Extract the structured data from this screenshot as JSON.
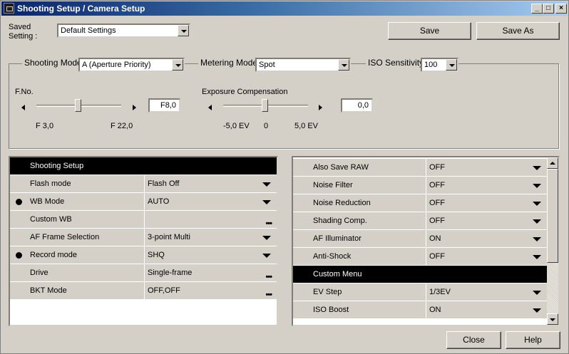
{
  "window": {
    "title": "Shooting Setup / Camera Setup"
  },
  "saved_setting": {
    "label_line1": "Saved",
    "label_line2": "Setting :",
    "value": "Default Settings",
    "save_label": "Save",
    "save_as_label": "Save As"
  },
  "shooting_mode": {
    "label": "Shooting Mode",
    "value": "A (Aperture Priority)"
  },
  "metering_mode": {
    "label": "Metering Mode",
    "value": "Spot"
  },
  "iso": {
    "label": "ISO Sensitivity",
    "value": "100"
  },
  "fno": {
    "label": "F.No.",
    "value": "F8,0",
    "min_label": "F 3,0",
    "max_label": "F 22,0",
    "level": 0.5
  },
  "exposure": {
    "label": "Exposure Compensation",
    "value": "0,0",
    "min_label": "-5,0 EV",
    "mid_label": "0",
    "max_label": "5,0 EV",
    "level": 0.5
  },
  "left_table": {
    "header": "Shooting Setup",
    "rows": [
      {
        "name": "Flash mode",
        "value": "Flash Off",
        "control": "dropdown",
        "bullet": false
      },
      {
        "name": "WB Mode",
        "value": "AUTO",
        "control": "dropdown",
        "bullet": true
      },
      {
        "name": "Custom WB",
        "value": "",
        "control": "ellipsis",
        "bullet": false
      },
      {
        "name": "AF Frame Selection",
        "value": "3-point Multi",
        "control": "dropdown",
        "bullet": false
      },
      {
        "name": "Record mode",
        "value": "SHQ",
        "control": "dropdown",
        "bullet": true
      },
      {
        "name": "Drive",
        "value": "Single-frame",
        "control": "ellipsis",
        "bullet": false
      },
      {
        "name": "BKT Mode",
        "value": "OFF,OFF",
        "control": "ellipsis",
        "bullet": false
      }
    ]
  },
  "right_table": {
    "rows": [
      {
        "name": "Also Save RAW",
        "value": "OFF",
        "control": "dropdown"
      },
      {
        "name": "Noise Filter",
        "value": "OFF",
        "control": "dropdown"
      },
      {
        "name": "Noise Reduction",
        "value": "OFF",
        "control": "dropdown"
      },
      {
        "name": "Shading Comp.",
        "value": "OFF",
        "control": "dropdown"
      },
      {
        "name": "AF Illuminator",
        "value": "ON",
        "control": "dropdown"
      },
      {
        "name": "Anti-Shock",
        "value": "OFF",
        "control": "dropdown"
      },
      {
        "name": "Custom Menu",
        "value": "",
        "control": "header"
      },
      {
        "name": "EV Step",
        "value": "1/3EV",
        "control": "dropdown"
      },
      {
        "name": "ISO Boost",
        "value": "ON",
        "control": "dropdown"
      }
    ]
  },
  "footer": {
    "close_label": "Close",
    "help_label": "Help"
  },
  "icons": {
    "app": "camera-icon",
    "minimize": "minimize-icon",
    "maximize": "maximize-icon",
    "close": "close-icon",
    "ellipsis": "ellipsis-icon",
    "dropdown": "dropdown-arrow-icon"
  }
}
